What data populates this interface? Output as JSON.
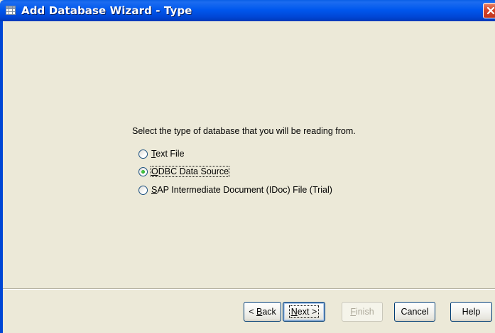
{
  "window": {
    "title": "Add Database Wizard - Type",
    "colors": {
      "titlebar": "#0058EE",
      "close": "#D5452A",
      "face": "#ECE9D8"
    }
  },
  "prompt": "Select the type of database that you will be reading from.",
  "options": [
    {
      "accel": "T",
      "rest": "ext File",
      "selected": false
    },
    {
      "accel": "O",
      "rest": "DBC Data Source",
      "selected": true
    },
    {
      "accel": "S",
      "rest": "AP Intermediate Document (IDoc) File (Trial)",
      "selected": false
    }
  ],
  "buttons": {
    "back": {
      "prefix": "< ",
      "accel": "B",
      "rest": "ack"
    },
    "next": {
      "accel": "N",
      "rest": "ext",
      "suffix": " >"
    },
    "finish": {
      "accel": "F",
      "rest": "inish"
    },
    "cancel": "Cancel",
    "help": "Help"
  },
  "icons": {
    "app": "database-grid-icon",
    "close": "close-icon"
  }
}
